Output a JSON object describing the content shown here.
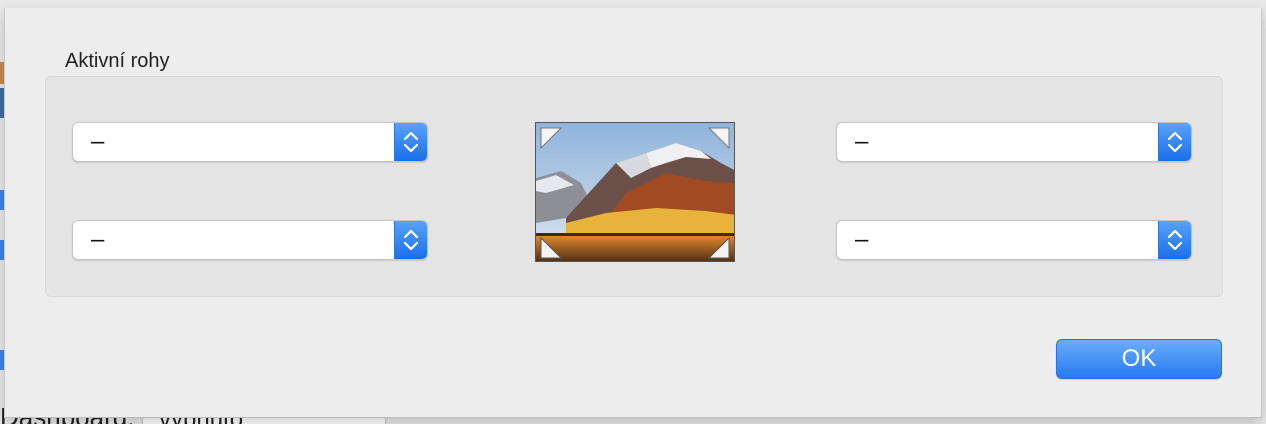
{
  "background": {
    "bottom_label": "Dashboard:",
    "bottom_popup_value": "vypnuto"
  },
  "sheet": {
    "title": "Aktivní rohy",
    "corners": {
      "top_left": {
        "value": "–"
      },
      "bottom_left": {
        "value": "–"
      },
      "top_right": {
        "value": "–"
      },
      "bottom_right": {
        "value": "–"
      }
    },
    "preview_icon": "desktop-preview-image",
    "ok_label": "OK"
  },
  "colors": {
    "accent": "#2679f0",
    "sheet_bg": "#ededed",
    "group_bg": "#e4e4e4"
  }
}
